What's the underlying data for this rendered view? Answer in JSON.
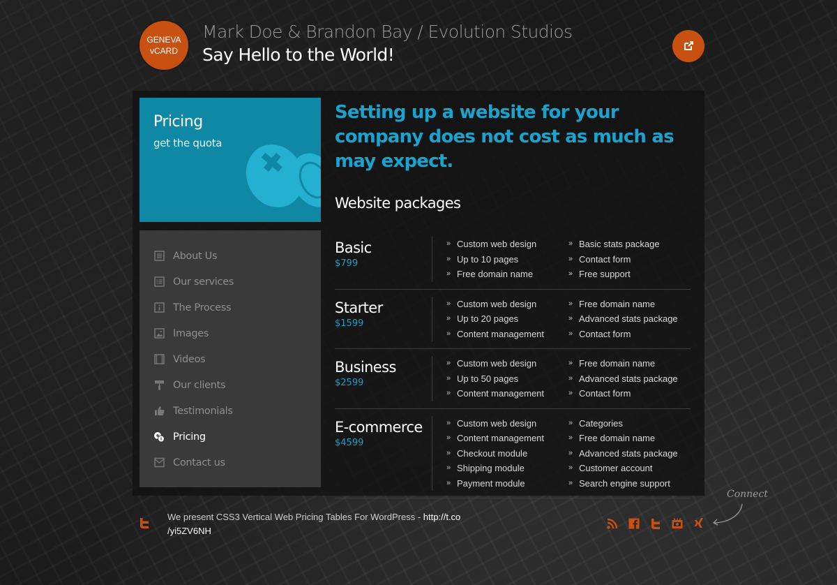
{
  "header": {
    "logo_line1": "GENEVA",
    "logo_line2": "vCARD",
    "site_name": "Mark Doe & Brandon Bay / Evolution Studios",
    "slogan": "Say Hello to the World!",
    "share_icon": "external-link-icon"
  },
  "hero": {
    "title": "Pricing",
    "subtitle": "get the quota",
    "icon": "coins-icon"
  },
  "nav": {
    "items": [
      {
        "label": "About Us",
        "icon": "document-icon"
      },
      {
        "label": "Our services",
        "icon": "list-icon"
      },
      {
        "label": "The Process",
        "icon": "info-icon"
      },
      {
        "label": "Images",
        "icon": "image-icon"
      },
      {
        "label": "Videos",
        "icon": "video-icon"
      },
      {
        "label": "Our clients",
        "icon": "paint-roller-icon"
      },
      {
        "label": "Testimonials",
        "icon": "thumbs-up-icon"
      },
      {
        "label": "Pricing",
        "icon": "coins-icon",
        "active": true
      },
      {
        "label": "Contact us",
        "icon": "envelope-icon"
      }
    ]
  },
  "content": {
    "headline": "Setting up a website for your company does not cost as much as may expect.",
    "section_title": "Website packages",
    "packages": [
      {
        "name": "Basic",
        "price": "$799",
        "features": [
          "Custom web design",
          "Basic stats package",
          "Up to 10 pages",
          "Contact form",
          "Free domain name",
          "Free support"
        ]
      },
      {
        "name": "Starter",
        "price": "$1599",
        "features": [
          "Custom web design",
          "Free domain name",
          "Up to 20 pages",
          "Advanced stats package",
          "Content management",
          "Contact form"
        ]
      },
      {
        "name": "Business",
        "price": "$2599",
        "features": [
          "Custom web design",
          "Free domain name",
          "Up to 50 pages",
          "Advanced stats package",
          "Content management",
          "Contact form"
        ]
      },
      {
        "name": "E-commerce",
        "price": "$4599",
        "features": [
          "Custom web design",
          "Categories",
          "Content management",
          "Free domain name",
          "Checkout module",
          "Advanced stats package",
          "Shipping module",
          "Customer account",
          "Payment module",
          "Search engine support"
        ]
      }
    ]
  },
  "footer": {
    "tweet_text": "We present CSS3 Vertical Web Pricing Tables For WordPress - ",
    "tweet_link_part1": "http://t.co",
    "tweet_link_part2": "/yi5ZV6NH",
    "connect_label": "Connect",
    "social": [
      "rss-icon",
      "facebook-icon",
      "twitter-icon",
      "youtube-icon",
      "xing-icon"
    ]
  },
  "colors": {
    "accent_orange": "#c85111",
    "accent_blue": "#1aa3cc",
    "hero_blue": "#0f88a6"
  }
}
